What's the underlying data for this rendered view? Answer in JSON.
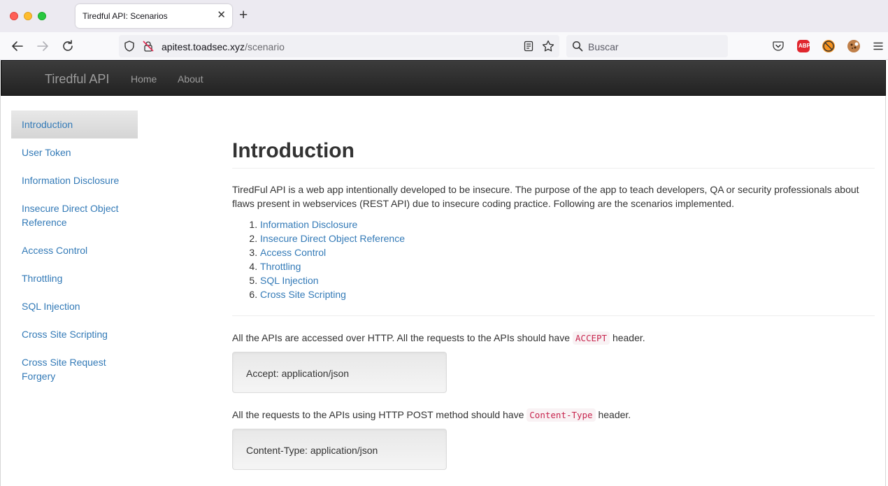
{
  "browser": {
    "tab_title": "Tiredful API: Scenarios",
    "tab_close": "✕",
    "new_tab": "+",
    "url_domain": "apitest.toadsec.xyz",
    "url_path": "/scenario",
    "search_placeholder": "Buscar",
    "extensions": {
      "abp_label": "ABP"
    }
  },
  "site": {
    "brand": "Tiredful API",
    "nav": [
      "Home",
      "About"
    ]
  },
  "sidebar": {
    "items": [
      {
        "label": "Introduction",
        "active": true
      },
      {
        "label": "User Token"
      },
      {
        "label": "Information Disclosure"
      },
      {
        "label": "Insecure Direct Object Reference"
      },
      {
        "label": "Access Control"
      },
      {
        "label": "Throttling"
      },
      {
        "label": "SQL Injection"
      },
      {
        "label": "Cross Site Scripting"
      },
      {
        "label": "Cross Site Request Forgery"
      }
    ]
  },
  "main": {
    "title": "Introduction",
    "intro": "TiredFul API is a web app intentionally developed to be insecure. The purpose of the app to teach developers, QA or security professionals about flaws present in webservices (REST API) due to insecure coding practice. Following are the scenarios implemented.",
    "scenarios": [
      "Information Disclosure",
      "Insecure Direct Object Reference",
      "Access Control",
      "Throttling",
      "SQL Injection",
      "Cross Site Scripting"
    ],
    "http_note_before": "All the APIs are accessed over HTTP. All the requests to the APIs should have",
    "http_note_code": "ACCEPT",
    "http_note_after": "header.",
    "accept_header": "Accept: application/json",
    "post_note_before": "All the requests to the APIs using HTTP POST method should have",
    "post_note_code": "Content-Type",
    "post_note_after": "header.",
    "content_type_header": "Content-Type: application/json"
  }
}
